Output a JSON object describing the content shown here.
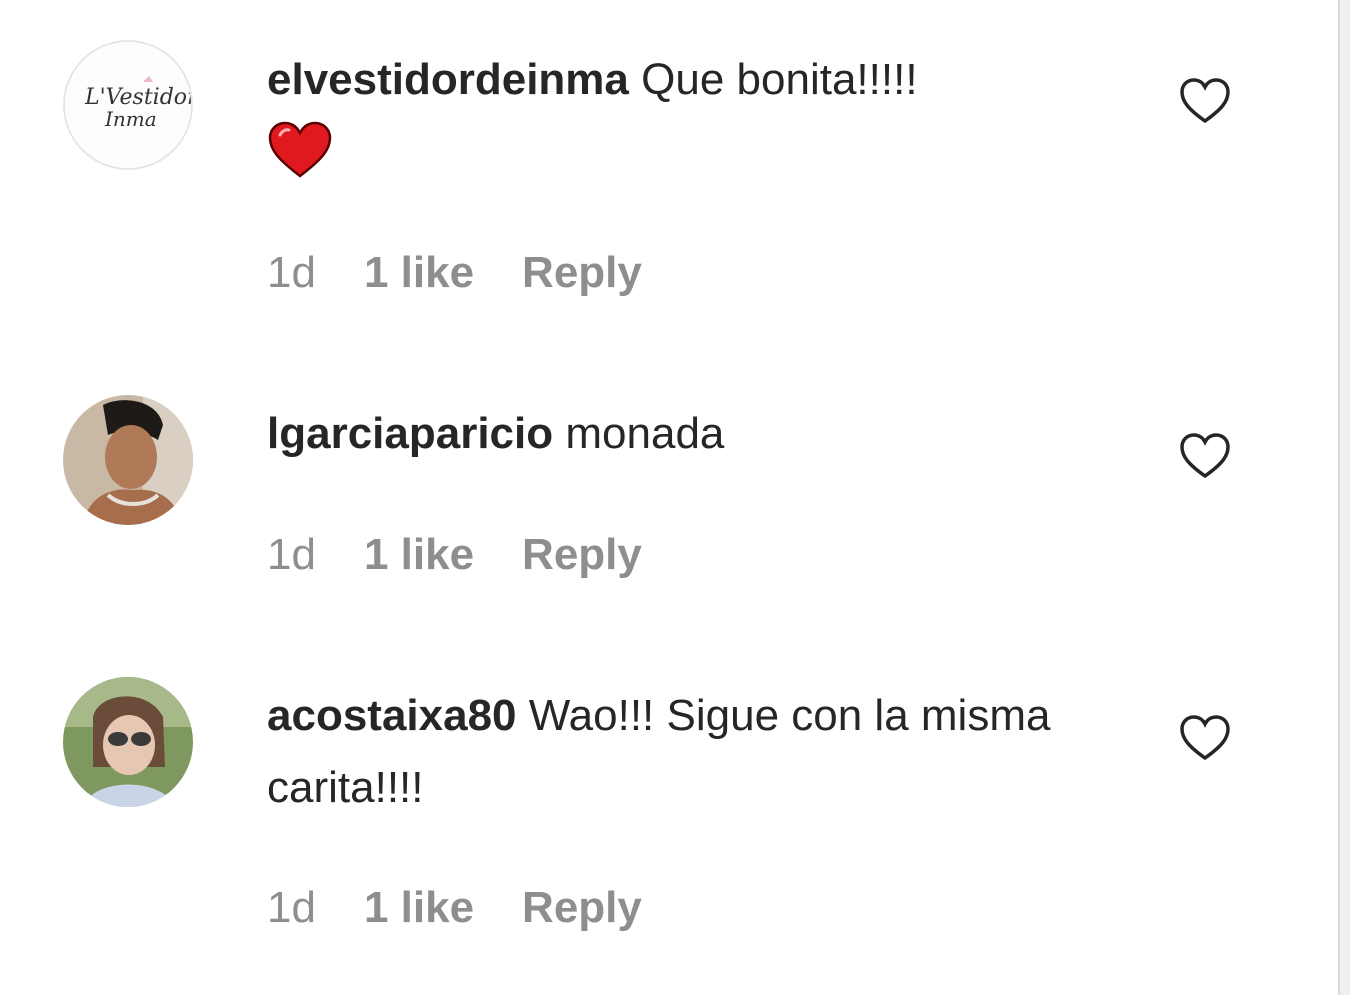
{
  "comments": [
    {
      "username": "elvestidordeinma",
      "text": "Que bonita!!!!!",
      "emoji": "red-heart",
      "time": "1d",
      "likes": "1 like",
      "reply": "Reply",
      "avatar_text": "L'Vestidor Inma"
    },
    {
      "username": "lgarciaparicio",
      "text": "monada",
      "time": "1d",
      "likes": "1 like",
      "reply": "Reply"
    },
    {
      "username": "acostaixa80",
      "text": "Wao!!! Sigue con la misma carita!!!!",
      "time": "1d",
      "likes": "1 like",
      "reply": "Reply"
    }
  ],
  "icons": {
    "like": "heart-outline-icon",
    "emoji": "red-heart-emoji"
  },
  "colors": {
    "text": "#262626",
    "meta": "#8e8e8e",
    "heart_emoji": "#e0191f"
  }
}
